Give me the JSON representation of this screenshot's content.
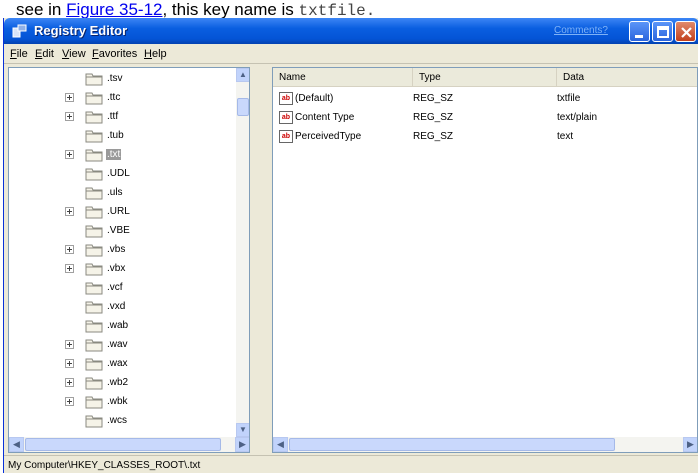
{
  "caption": {
    "prefix": "see in ",
    "link": "Figure 35-12",
    "middle": ", this key name is ",
    "code": "txtfile."
  },
  "window": {
    "title": "Registry Editor",
    "comments_link": "Comments?",
    "titlebar_color": "#0454d6"
  },
  "menu": {
    "file": "File",
    "edit": "Edit",
    "view": "View",
    "favorites": "Favorites",
    "help": "Help"
  },
  "tree": {
    "items": [
      {
        "label": ".tsv",
        "expandable": false,
        "selected": false
      },
      {
        "label": ".ttc",
        "expandable": true,
        "selected": false
      },
      {
        "label": ".ttf",
        "expandable": true,
        "selected": false
      },
      {
        "label": ".tub",
        "expandable": false,
        "selected": false
      },
      {
        "label": ".txt",
        "expandable": true,
        "selected": true
      },
      {
        "label": ".UDL",
        "expandable": false,
        "selected": false
      },
      {
        "label": ".uls",
        "expandable": false,
        "selected": false
      },
      {
        "label": ".URL",
        "expandable": true,
        "selected": false
      },
      {
        "label": ".VBE",
        "expandable": false,
        "selected": false
      },
      {
        "label": ".vbs",
        "expandable": true,
        "selected": false
      },
      {
        "label": ".vbx",
        "expandable": true,
        "selected": false
      },
      {
        "label": ".vcf",
        "expandable": false,
        "selected": false
      },
      {
        "label": ".vxd",
        "expandable": false,
        "selected": false
      },
      {
        "label": ".wab",
        "expandable": false,
        "selected": false
      },
      {
        "label": ".wav",
        "expandable": true,
        "selected": false
      },
      {
        "label": ".wax",
        "expandable": true,
        "selected": false
      },
      {
        "label": ".wb2",
        "expandable": true,
        "selected": false
      },
      {
        "label": ".wbk",
        "expandable": true,
        "selected": false
      },
      {
        "label": ".wcs",
        "expandable": false,
        "selected": false
      }
    ]
  },
  "list": {
    "headers": {
      "name": "Name",
      "type": "Type",
      "data": "Data"
    },
    "rows": [
      {
        "name": "(Default)",
        "type": "REG_SZ",
        "data": "txtfile"
      },
      {
        "name": "Content Type",
        "type": "REG_SZ",
        "data": "text/plain"
      },
      {
        "name": "PerceivedType",
        "type": "REG_SZ",
        "data": "text"
      }
    ]
  },
  "icons": {
    "folder": "folder-icon",
    "string_value": "ab-string-value-icon",
    "app": "registry-editor-icon"
  },
  "status": {
    "path": "My Computer\\HKEY_CLASSES_ROOT\\.txt"
  }
}
